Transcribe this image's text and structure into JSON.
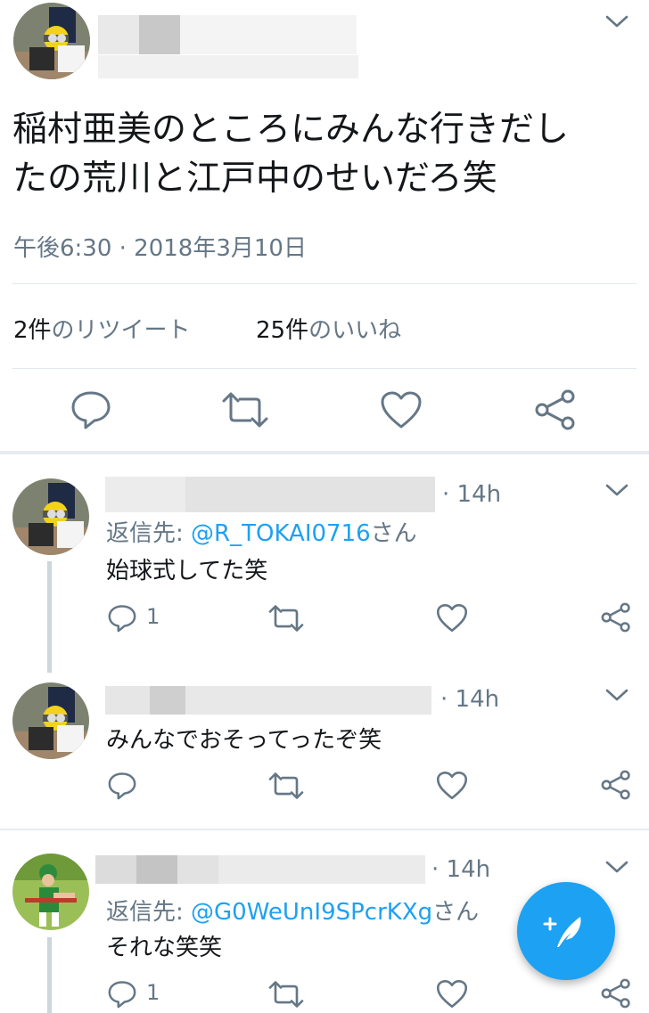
{
  "main_tweet": {
    "text_line1": "稲村亜美のところにみんな行きだし",
    "text_line2": "たの荒川と江戸中のせいだろ笑",
    "timestamp": "午後6:30 · 2018年3月10日",
    "retweets_count": "2件",
    "retweets_label": "のリツイート",
    "likes_count": "25件",
    "likes_label": "のいいね"
  },
  "replies": [
    {
      "time": "· 14h",
      "reply_prefix": "返信先: ",
      "reply_handle": "@R_TOKAI0716",
      "reply_suffix": "さん",
      "text": "始球式してた笑",
      "reply_count": "1"
    },
    {
      "time": "· 14h",
      "text": "みんなでおそってったぞ笑"
    },
    {
      "time": "· 14h",
      "reply_prefix": "返信先: ",
      "reply_handle": "@G0WeUnI9SPcrKXg",
      "reply_suffix": "さん",
      "text": "それな笑笑",
      "reply_count": "1"
    }
  ],
  "icons": {
    "reply": "reply-icon",
    "retweet": "retweet-icon",
    "like": "heart-icon",
    "share": "share-icon",
    "menu": "chevron-down-icon",
    "compose": "compose-icon"
  },
  "colors": {
    "accent": "#1da1f2",
    "muted": "#657786",
    "icon": "#657786",
    "text": "#14171a"
  }
}
